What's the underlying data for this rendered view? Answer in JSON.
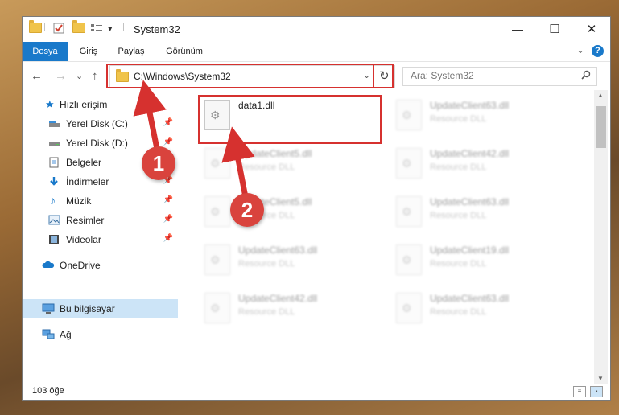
{
  "window": {
    "title": "System32",
    "quick_access": [
      "folder-icon",
      "properties-icon",
      "new-folder-icon",
      "customize-icon"
    ],
    "qa_dropdown": "▾",
    "controls": {
      "minimize": "—",
      "maximize": "☐",
      "close": "✕"
    }
  },
  "ribbon": {
    "tabs": [
      "Dosya",
      "Giriş",
      "Paylaş",
      "Görünüm"
    ],
    "help": "?",
    "collapse": "⌄"
  },
  "nav": {
    "back": "←",
    "forward": "→",
    "recent": "⌄",
    "up": "↑",
    "address": "C:\\Windows\\System32",
    "address_dropdown": "⌄",
    "refresh": "↻",
    "search_placeholder": "Ara: System32"
  },
  "sidebar": {
    "items": [
      {
        "label": "Hızlı erişim",
        "icon": "star-icon",
        "pinned": false
      },
      {
        "label": "Yerel Disk (C:)",
        "icon": "drive-icon",
        "pinned": true
      },
      {
        "label": "Yerel Disk (D:)",
        "icon": "drive-icon",
        "pinned": true
      },
      {
        "label": "Belgeler",
        "icon": "documents-icon",
        "pinned": true
      },
      {
        "label": "İndirmeler",
        "icon": "downloads-icon",
        "pinned": true
      },
      {
        "label": "Müzik",
        "icon": "music-icon",
        "pinned": true
      },
      {
        "label": "Resimler",
        "icon": "pictures-icon",
        "pinned": true
      },
      {
        "label": "Videolar",
        "icon": "videos-icon",
        "pinned": true
      },
      {
        "label": "OneDrive",
        "icon": "cloud-icon",
        "pinned": false
      },
      {
        "label": "Bu bilgisayar",
        "icon": "computer-icon",
        "pinned": false,
        "selected": true
      },
      {
        "label": "Ağ",
        "icon": "network-icon",
        "pinned": false
      }
    ],
    "pin_glyph": "📌"
  },
  "files": [
    {
      "name": "data1.dll",
      "type": "",
      "highlighted": true
    },
    {
      "name": "UpdateClient63.dll",
      "type": "Resource DLL"
    },
    {
      "name": "UpdateClient5.dll",
      "type": "Resource DLL"
    },
    {
      "name": "UpdateClient42.dll",
      "type": "Resource DLL"
    },
    {
      "name": "UpdateClient5.dll",
      "type": "Resource DLL"
    },
    {
      "name": "UpdateClient63.dll",
      "type": "Resource DLL"
    },
    {
      "name": "UpdateClient63.dll",
      "type": "Resource DLL"
    },
    {
      "name": "UpdateClient19.dll",
      "type": "Resource DLL"
    },
    {
      "name": "UpdateClient42.dll",
      "type": "Resource DLL"
    },
    {
      "name": "UpdateClient63.dll",
      "type": "Resource DLL"
    }
  ],
  "status": {
    "count": "103 öğe"
  },
  "annotations": {
    "marker1": "1",
    "marker2": "2",
    "accent": "#d6312f"
  }
}
